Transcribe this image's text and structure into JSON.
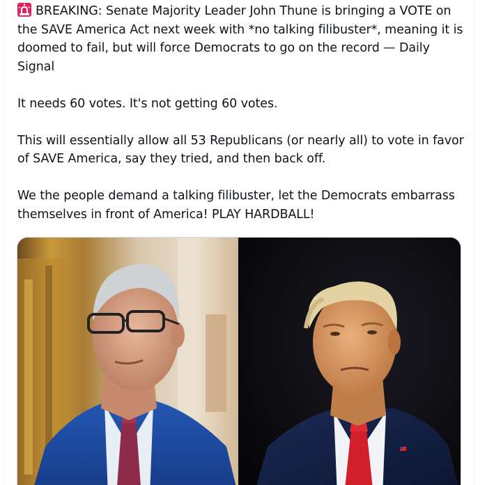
{
  "tweet": {
    "paragraphs": [
      {
        "icon": "rotating-light-siren-icon",
        "text": "BREAKING: Senate Majority Leader John Thune is bringing a VOTE on the SAVE America Act next week with *no talking filibuster*, meaning it is doomed to fail, but will force Democrats to go on the record — Daily Signal"
      },
      {
        "text": "It needs 60 votes. It's not getting 60 votes."
      },
      {
        "text": "This will essentially allow all 53 Republicans (or nearly all) to vote in favor of SAVE America, say they tried, and then back off."
      },
      {
        "text": "We the people demand a talking filibuster, let the Democrats embarrass themselves in front of America! PLAY HARDBALL!"
      }
    ]
  },
  "media": {
    "photos": [
      {
        "subject": "man-with-glasses-blue-suit-photo"
      },
      {
        "subject": "man-red-tie-dark-background-photo"
      }
    ]
  },
  "colors": {
    "text": "#0f1419",
    "border": "#cfd9de",
    "siren": "#e0245e"
  }
}
